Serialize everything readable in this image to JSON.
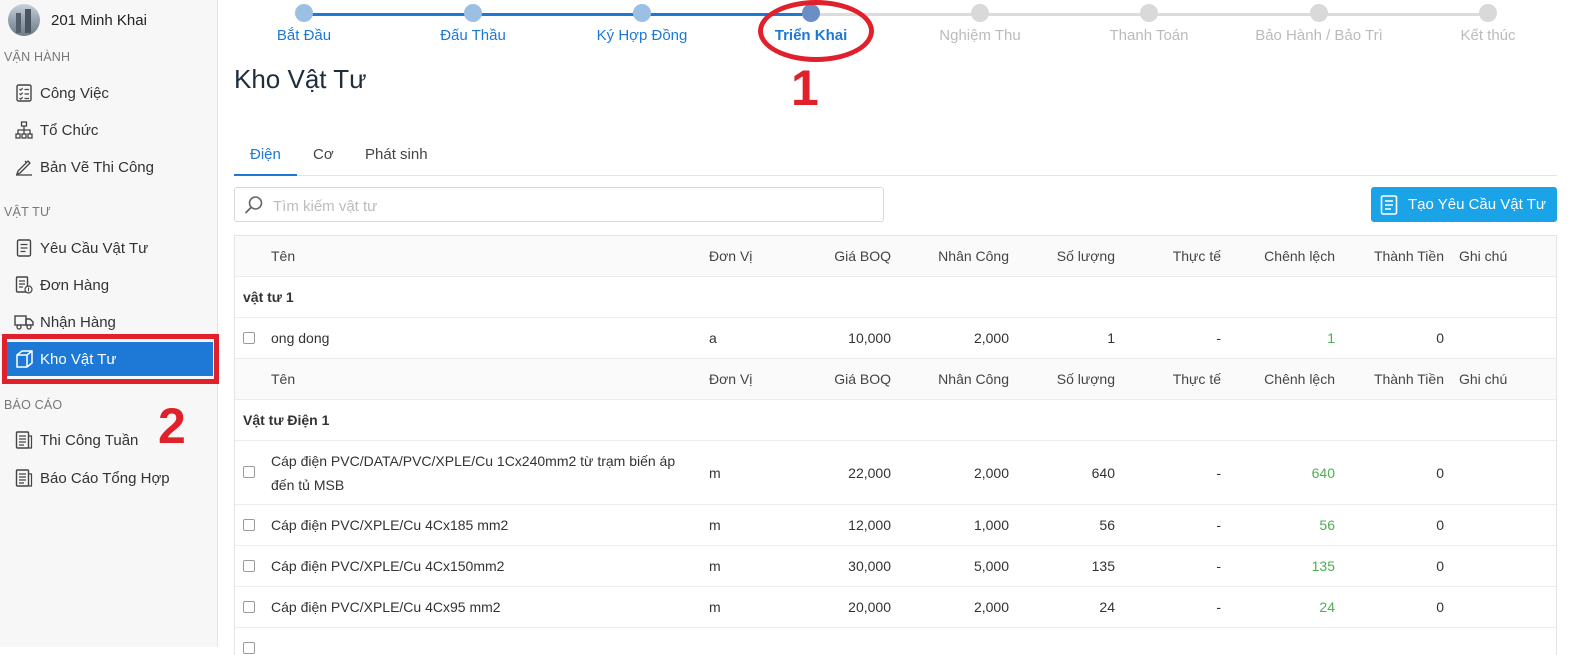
{
  "sidebar": {
    "project_title": "201 Minh Khai",
    "sections": [
      {
        "label": "VẬN HÀNH",
        "items": [
          "Công Việc",
          "Tổ Chức",
          "Bản Vẽ Thi Công"
        ]
      },
      {
        "label": "VẬT TƯ",
        "items": [
          "Yêu Cầu Vật Tư",
          "Đơn Hàng",
          "Nhận Hàng",
          "Kho Vật Tư"
        ]
      },
      {
        "label": "BÁO CÁO",
        "items": [
          "Thi Công Tuần",
          "Báo Cáo Tổng Hợp"
        ]
      }
    ],
    "active_item": "Kho Vật Tư"
  },
  "annotations": {
    "marker_1": "1",
    "marker_2": "2",
    "color": "#e0202a"
  },
  "stepper": {
    "steps": [
      {
        "label": "Bắt Đầu",
        "state": "done"
      },
      {
        "label": "Đấu Thầu",
        "state": "done"
      },
      {
        "label": "Ký Hợp Đồng",
        "state": "done"
      },
      {
        "label": "Triển Khai",
        "state": "current"
      },
      {
        "label": "Nghiệm Thu",
        "state": "todo"
      },
      {
        "label": "Thanh Toán",
        "state": "todo"
      },
      {
        "label": "Bảo Hành / Bảo Trì",
        "state": "todo"
      },
      {
        "label": "Kết thúc",
        "state": "todo"
      }
    ]
  },
  "page": {
    "title": "Kho Vật Tư"
  },
  "tabs": [
    {
      "label": "Điện",
      "active": true
    },
    {
      "label": "Cơ",
      "active": false
    },
    {
      "label": "Phát sinh",
      "active": false
    }
  ],
  "search": {
    "placeholder": "Tìm kiếm vật tư",
    "value": ""
  },
  "create_button": {
    "label": "Tạo Yêu Cầu Vật Tư"
  },
  "table": {
    "columns": [
      "Tên",
      "Đơn Vị",
      "Giá BOQ",
      "Nhân Công",
      "Số lượng",
      "Thực tế",
      "Chênh lệch",
      "Thành Tiền",
      "Ghi chú"
    ],
    "groups": [
      {
        "name": "vật tư 1",
        "rows": [
          {
            "name": "ong dong",
            "unit": "a",
            "boq": "10,000",
            "labor": "2,000",
            "qty": "1",
            "actual": "-",
            "diff": "1",
            "total": "0",
            "note": ""
          }
        ]
      },
      {
        "name": "Vật tư Điện 1",
        "rows": [
          {
            "name": "Cáp điện PVC/DATA/PVC/XPLE/Cu 1Cx240mm2 từ trạm biến áp đến tủ MSB",
            "unit": "m",
            "boq": "22,000",
            "labor": "2,000",
            "qty": "640",
            "actual": "-",
            "diff": "640",
            "total": "0",
            "note": ""
          },
          {
            "name": "Cáp điện PVC/XPLE/Cu 4Cx185 mm2",
            "unit": "m",
            "boq": "12,000",
            "labor": "1,000",
            "qty": "56",
            "actual": "-",
            "diff": "56",
            "total": "0",
            "note": ""
          },
          {
            "name": "Cáp điện PVC/XPLE/Cu 4Cx150mm2",
            "unit": "m",
            "boq": "30,000",
            "labor": "5,000",
            "qty": "135",
            "actual": "-",
            "diff": "135",
            "total": "0",
            "note": ""
          },
          {
            "name": "Cáp điện PVC/XPLE/Cu 4Cx95 mm2",
            "unit": "m",
            "boq": "20,000",
            "labor": "2,000",
            "qty": "24",
            "actual": "-",
            "diff": "24",
            "total": "0",
            "note": ""
          }
        ]
      }
    ]
  }
}
